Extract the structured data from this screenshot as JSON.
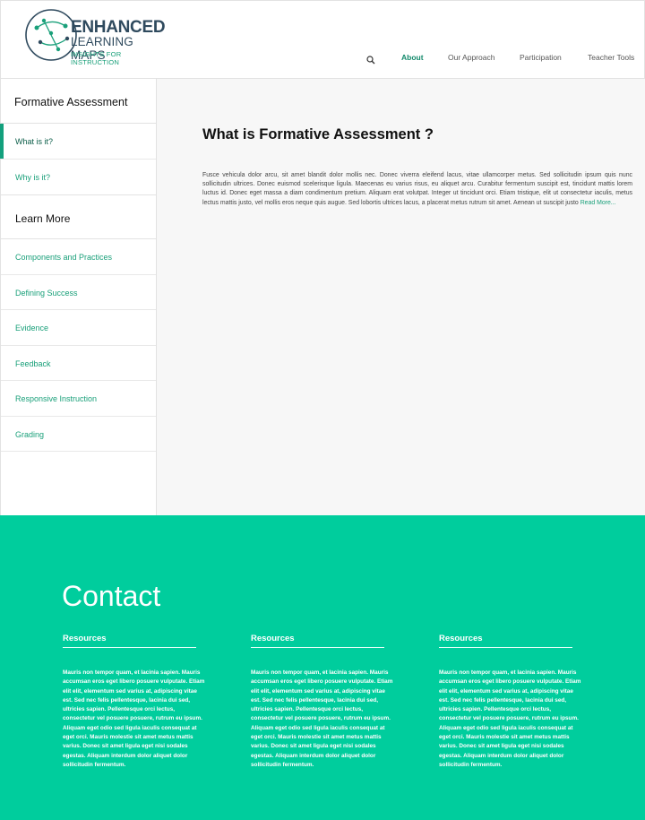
{
  "brand": {
    "line1": "ENHANCED",
    "line2": "LEARNING MAPS",
    "tagline": "INSIGHTS FOR INSTRUCTION",
    "accent": "#1aa07a",
    "navy": "#2f4a5e"
  },
  "nav": {
    "search_icon": "search-icon",
    "items": [
      {
        "label": "About",
        "active": true
      },
      {
        "label": "Our Approach"
      },
      {
        "label": "Participation"
      },
      {
        "label": "Teacher Tools"
      }
    ]
  },
  "sidebar": {
    "section_title": "Formative Assessment",
    "items": [
      {
        "label": "What is it?",
        "active": true
      },
      {
        "label": "Why is it?"
      }
    ],
    "learn_more_title": "Learn More",
    "learn_more_items": [
      {
        "label": "Components and Practices"
      },
      {
        "label": "Defining Success"
      },
      {
        "label": "Evidence"
      },
      {
        "label": "Feedback"
      },
      {
        "label": "Responsive Instruction"
      },
      {
        "label": "Grading"
      }
    ]
  },
  "main": {
    "title": "What is Formative Assessment ?",
    "body": "Fusce vehicula dolor arcu, sit amet blandit dolor mollis nec. Donec viverra eleifend lacus, vitae ullamcorper metus. Sed sollicitudin ipsum quis nunc sollicitudin ultrices. Donec euismod scelerisque ligula. Maecenas eu varius risus, eu aliquet arcu. Curabitur fermentum suscipit est, tincidunt mattis lorem luctus id. Donec eget massa a diam condimentum pretium. Aliquam erat volutpat. Integer ut tincidunt orci. Etiam tristique, elit ut consectetur iaculis, metus lectus mattis justo, vel mollis eros neque quis augue. Sed lobortis ultrices lacus, a placerat metus rutrum sit amet. Aenean ut suscipit justo",
    "read_more": "Read More..."
  },
  "footer": {
    "title": "Contact",
    "background": "#00cd9d",
    "columns": [
      {
        "title": "Resources",
        "body": "Mauris non tempor quam, et lacinia sapien. Mauris accumsan eros eget libero posuere vulputate. Etiam elit elit, elementum sed varius at, adipiscing vitae est. Sed nec felis pellentesque, lacinia dui sed, ultricies sapien. Pellentesque orci lectus, consectetur vel posuere posuere, rutrum eu ipsum. Aliquam eget odio sed ligula iaculis consequat at eget orci. Mauris molestie sit amet metus mattis varius. Donec sit amet ligula eget nisi sodales egestas. Aliquam interdum dolor aliquet dolor sollicitudin fermentum."
      },
      {
        "title": "Resources",
        "body": "Mauris non tempor quam, et lacinia sapien. Mauris accumsan eros eget libero posuere vulputate. Etiam elit elit, elementum sed varius at, adipiscing vitae est. Sed nec felis pellentesque, lacinia dui sed, ultricies sapien. Pellentesque orci lectus, consectetur vel posuere posuere, rutrum eu ipsum. Aliquam eget odio sed ligula iaculis consequat at eget orci. Mauris molestie sit amet metus mattis varius. Donec sit amet ligula eget nisi sodales egestas. Aliquam interdum dolor aliquet dolor sollicitudin fermentum."
      },
      {
        "title": "Resources",
        "body": "Mauris non tempor quam, et lacinia sapien. Mauris accumsan eros eget libero posuere vulputate. Etiam elit elit, elementum sed varius at, adipiscing vitae est. Sed nec felis pellentesque, lacinia dui sed, ultricies sapien. Pellentesque orci lectus, consectetur vel posuere posuere, rutrum eu ipsum. Aliquam eget odio sed ligula iaculis consequat at eget orci. Mauris molestie sit amet metus mattis varius. Donec sit amet ligula eget nisi sodales egestas. Aliquam interdum dolor aliquet dolor sollicitudin fermentum."
      }
    ]
  }
}
